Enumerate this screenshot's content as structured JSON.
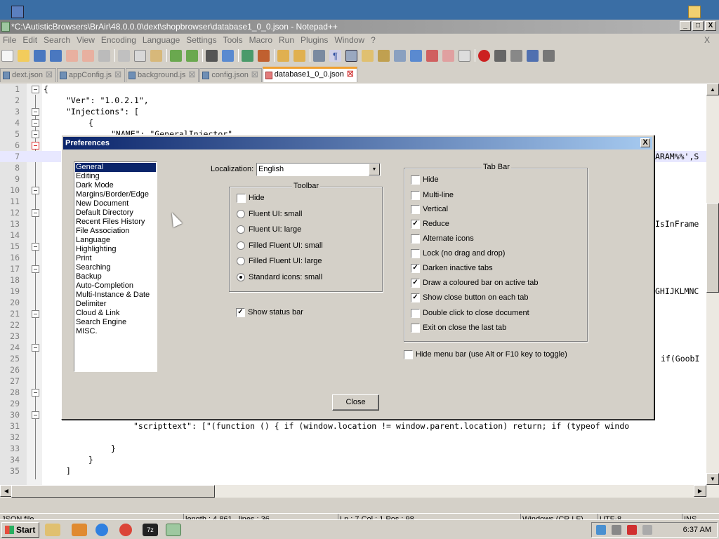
{
  "window": {
    "title": "*C:\\AutisticBrowsers\\BrAir\\48.0.0.0\\dext\\shopbrowser\\database1_0_0.json - Notepad++",
    "controls": [
      "_",
      "□",
      "X"
    ]
  },
  "menubar": {
    "items": [
      "File",
      "Edit",
      "Search",
      "View",
      "Encoding",
      "Language",
      "Settings",
      "Tools",
      "Macro",
      "Run",
      "Plugins",
      "Window",
      "?"
    ],
    "close_label": "X"
  },
  "tabs": [
    {
      "label": "dext.json",
      "active": false
    },
    {
      "label": "appConfig.js",
      "active": false
    },
    {
      "label": "background.js",
      "active": false
    },
    {
      "label": "config.json",
      "active": false
    },
    {
      "label": "database1_0_0.json",
      "active": true
    }
  ],
  "editor": {
    "line_numbers": [
      "1",
      "2",
      "3",
      "4",
      "5",
      "6",
      "7",
      "8",
      "9",
      "10",
      "11",
      "12",
      "13",
      "14",
      "15",
      "16",
      "17",
      "18",
      "19",
      "20",
      "21",
      "22",
      "23",
      "24",
      "25",
      "26",
      "27",
      "28",
      "29",
      "30",
      "31",
      "32",
      "33",
      "34",
      "35"
    ],
    "lines": {
      "l1": "{",
      "l2": "\"Ver\": \"1.0.2.1\",",
      "l3": "\"Injections\": [",
      "l4": "{",
      "l5": "\"NAME\": \"GeneralInjector\",",
      "l7": "ARAM%%',S",
      "l13": "IsInFrame",
      "l19": "GHIJKLMNC",
      "l25": "if(GoobI",
      "l31": "\"scripttext\": [\"(function () { if (window.location != window.parent.location) return; if (typeof windo",
      "l33": "}",
      "l34": "}",
      "l35": "]"
    }
  },
  "statusbar": {
    "file_type": "JSON file",
    "length": "length : 4,861",
    "lines": "lines : 36",
    "position": "Ln : 7    Col : 1    Pos : 98",
    "eol": "Windows (CR LF)",
    "encoding": "UTF-8",
    "mode": "INS"
  },
  "dialog": {
    "title": "Preferences",
    "close_symbol": "X",
    "categories": [
      "General",
      "Editing",
      "Dark Mode",
      "Margins/Border/Edge",
      "New Document",
      "Default Directory",
      "Recent Files History",
      "File Association",
      "Language",
      "Highlighting",
      "Print",
      "Searching",
      "Backup",
      "Auto-Completion",
      "Multi-Instance & Date",
      "Delimiter",
      "Cloud & Link",
      "Search Engine",
      "MISC."
    ],
    "selected_category": "General",
    "localization_label": "Localization:",
    "localization_value": "English",
    "toolbar_group": {
      "title": "Toolbar",
      "hide_label": "Hide",
      "hide_checked": false,
      "options": [
        "Fluent UI: small",
        "Fluent UI: large",
        "Filled Fluent UI: small",
        "Filled Fluent UI: large",
        "Standard icons: small"
      ],
      "selected": "Standard icons: small"
    },
    "show_status_bar": {
      "label": "Show status bar",
      "checked": true
    },
    "tabbar_group": {
      "title": "Tab Bar",
      "options": [
        {
          "label": "Hide",
          "checked": false
        },
        {
          "label": "Multi-line",
          "checked": false
        },
        {
          "label": "Vertical",
          "checked": false
        },
        {
          "label": "Reduce",
          "checked": true
        },
        {
          "label": "Alternate icons",
          "checked": false
        },
        {
          "label": "Lock (no drag and drop)",
          "checked": false
        },
        {
          "label": "Darken inactive tabs",
          "checked": true
        },
        {
          "label": "Draw a coloured bar on active tab",
          "checked": true
        },
        {
          "label": "Show close button on each tab",
          "checked": true
        },
        {
          "label": "Double click to close document",
          "checked": false
        },
        {
          "label": "Exit on close the last tab",
          "checked": false
        }
      ]
    },
    "hide_menu_bar": {
      "label": "Hide menu bar (use Alt or F10 key to toggle)",
      "checked": false
    },
    "close_button": "Close"
  },
  "taskbar": {
    "start_label": "Start",
    "clock": "6:37 AM"
  },
  "colors": {
    "accent_titlebar": "#0a246a",
    "active_tab_bar": "#f0a030",
    "desktop": "#3a6ea5"
  }
}
